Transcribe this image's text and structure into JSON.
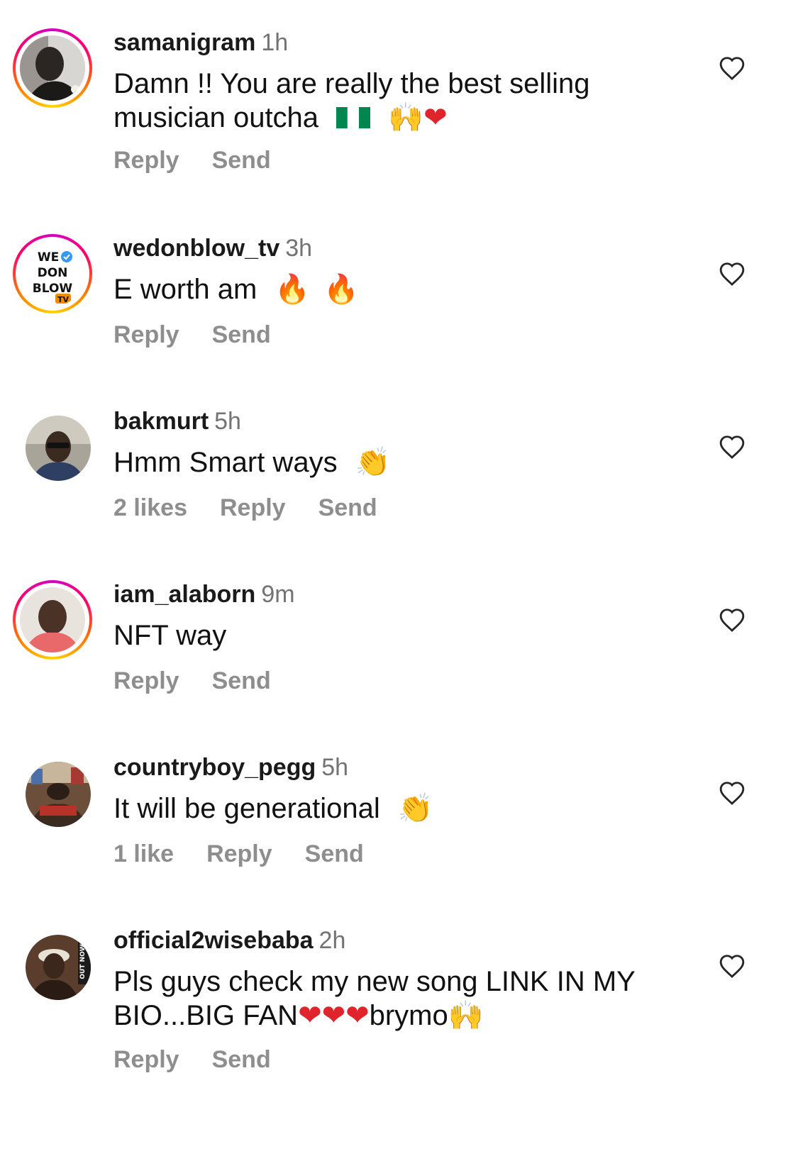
{
  "comments": [
    {
      "username": "samanigram",
      "time": "1h",
      "text_line1": "Damn !! You are really the best selling",
      "text_line2": "musician outcha",
      "emoji_names": [
        "nigeria-flag-icon",
        "raised-hands-icon",
        "red-heart-icon"
      ],
      "likes": "",
      "reply": "Reply",
      "send": "Send",
      "avatar_ring": true
    },
    {
      "username": "wedonblow_tv",
      "time": "3h",
      "text_line1": "E worth am",
      "emoji_names": [
        "fire-icon",
        "fire-icon"
      ],
      "likes": "",
      "reply": "Reply",
      "send": "Send",
      "avatar_ring": true,
      "avatar_logo_text": [
        "WE",
        "DON",
        "BLOW",
        "TV"
      ]
    },
    {
      "username": "bakmurt",
      "time": "5h",
      "text_line1": "Hmm Smart ways",
      "emoji_names": [
        "clapping-hands-icon"
      ],
      "likes": "2 likes",
      "reply": "Reply",
      "send": "Send",
      "avatar_ring": false
    },
    {
      "username": "iam_alaborn",
      "time": "9m",
      "text_line1": "NFT way",
      "emoji_names": [],
      "likes": "",
      "reply": "Reply",
      "send": "Send",
      "avatar_ring": true
    },
    {
      "username": "countryboy_pegg",
      "time": "5h",
      "text_line1": "It will be generational",
      "emoji_names": [
        "clapping-hands-icon"
      ],
      "likes": "1 like",
      "reply": "Reply",
      "send": "Send",
      "avatar_ring": false
    },
    {
      "username": "official2wisebaba",
      "time": "2h",
      "text_line1": "Pls guys check my new song LINK IN MY",
      "text_line2_a": "BIO...BIG FAN",
      "text_line2_b": "brymo",
      "emoji_names": [
        "red-heart-icon",
        "red-heart-icon",
        "red-heart-icon",
        "raised-hands-icon"
      ],
      "likes": "",
      "reply": "Reply",
      "send": "Send",
      "avatar_ring": false,
      "avatar_logo_text": [
        "OUT NOW"
      ]
    }
  ],
  "colors": {
    "username": "#1a1a1a",
    "time": "#737373",
    "actions": "#8e8e8e",
    "heart_outline": "#262626",
    "story_ring_start": "#d300c5",
    "story_ring_end": "#ffd600"
  }
}
